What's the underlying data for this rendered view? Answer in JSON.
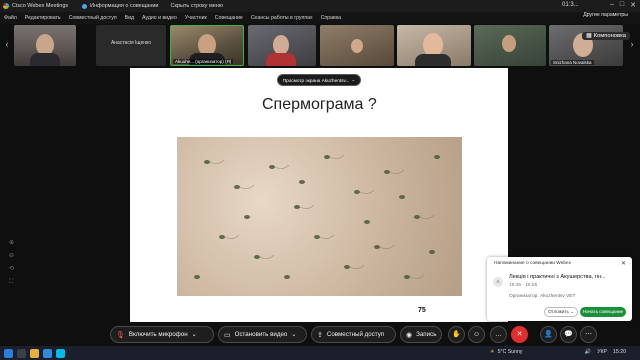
{
  "titlebar": {
    "app_name": "Cisco Webex Meetings",
    "meeting_info": "Информация о совещании",
    "hide_menu": "Скрыть строку меню",
    "clock": "01:3...",
    "controls": [
      "–",
      "□",
      "✕"
    ]
  },
  "menu": {
    "items": [
      "Файл",
      "Редактировать",
      "Совместный доступ",
      "Вид",
      "Аудио и видео",
      "Участник",
      "Совещание",
      "Сеансы работы в группах",
      "Справка"
    ],
    "other_params": "Другие параметры"
  },
  "participants": {
    "tiles": [
      {
        "name": ""
      },
      {
        "name": "Анастасія Іщенко",
        "no_video": true
      },
      {
        "name": "Akuuhe... (организатор) (Я)"
      },
      {
        "name": ""
      },
      {
        "name": ""
      },
      {
        "name": ""
      },
      {
        "name": ""
      },
      {
        "name": "Snizhana Novalska"
      }
    ],
    "layout_button": "Компоновка"
  },
  "stage": {
    "viewing_label": "Просмотр экрана Akuzhentsv...",
    "slide_title": "Спермограма ?",
    "page_number": "75"
  },
  "notification": {
    "header": "Напоминание о совещании Webex",
    "avatar_letter": "A",
    "title": "Лекція і практичні з Акушерства, гін...",
    "time": "15:35 - 16:55",
    "organizer": "Организатор: Akuzhentsv VET",
    "snooze_label": "Отложить",
    "start_label": "Начать совещание"
  },
  "controls": {
    "mic_label": "Включить микрофон",
    "video_label": "Остановить видео",
    "share_label": "Совместный доступ",
    "record_label": "Запись"
  },
  "taskbar": {
    "weather": "5°C Sunny",
    "lang": "УКР",
    "time": "15:20"
  },
  "colors": {
    "accent_green": "#1a8f3c",
    "leave_red": "#e22d2d",
    "mic_red": "#ff5a4e",
    "active_border": "#3bb14a"
  }
}
